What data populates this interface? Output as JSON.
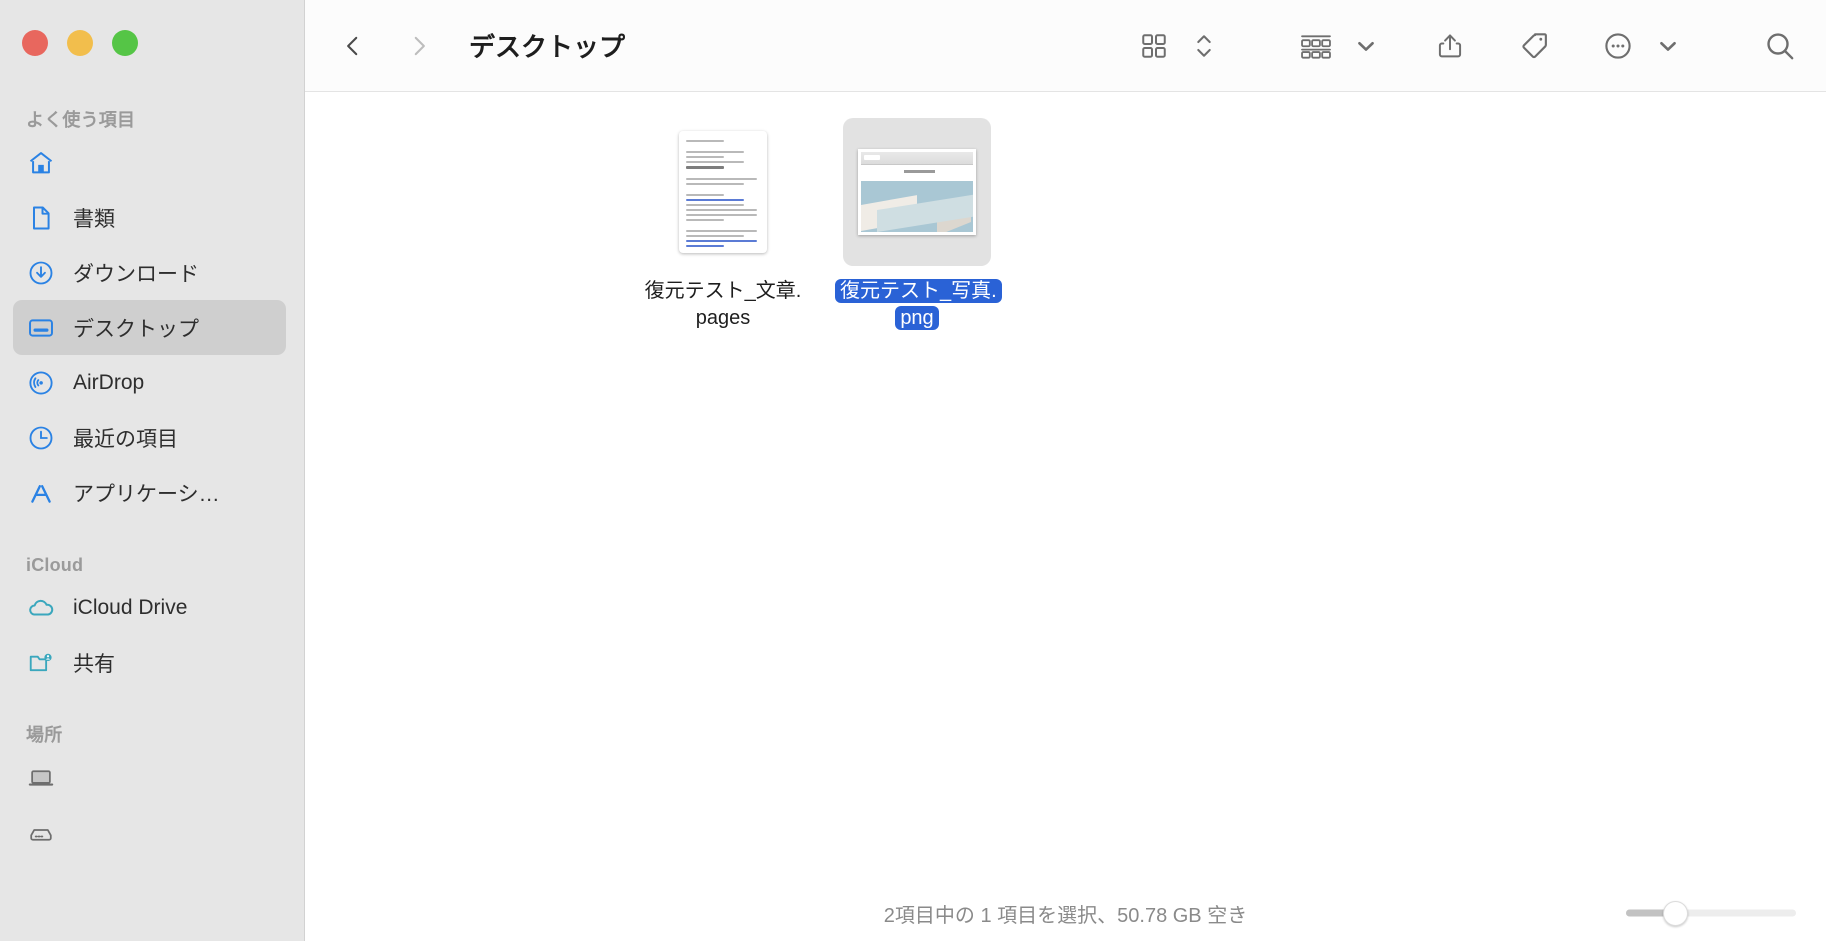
{
  "window": {
    "traffic_lights": [
      {
        "name": "close",
        "color": "#e8675e"
      },
      {
        "name": "minimize",
        "color": "#f2be4c"
      },
      {
        "name": "zoom",
        "color": "#55c546"
      }
    ]
  },
  "toolbar": {
    "back_label": "‹",
    "forward_label": "›",
    "folder_title": "デスクトップ",
    "icons": [
      "icon-view-icon",
      "view-sort-chevrons-icon",
      "group-by-icon",
      "group-by-chevron-icon",
      "share-icon",
      "tag-icon",
      "more-actions-icon",
      "more-actions-chevron-icon",
      "search-icon"
    ]
  },
  "sidebar": {
    "sections": [
      {
        "title": "よく使う項目",
        "items": [
          {
            "icon": "home-icon",
            "label": "",
            "selected": false
          },
          {
            "icon": "document-icon",
            "label": "書類",
            "selected": false
          },
          {
            "icon": "downloads-icon",
            "label": "ダウンロード",
            "selected": false
          },
          {
            "icon": "desktop-icon",
            "label": "デスクトップ",
            "selected": true
          },
          {
            "icon": "airdrop-icon",
            "label": "AirDrop",
            "selected": false
          },
          {
            "icon": "recents-clock-icon",
            "label": "最近の項目",
            "selected": false
          },
          {
            "icon": "applications-icon",
            "label": "アプリケーシ…",
            "selected": false
          }
        ]
      },
      {
        "title": "iCloud",
        "items": [
          {
            "icon": "cloud-icon",
            "label": "iCloud Drive",
            "selected": false
          },
          {
            "icon": "shared-folder-icon",
            "label": "共有",
            "selected": false
          }
        ]
      },
      {
        "title": "場所",
        "items": [
          {
            "icon": "laptop-icon",
            "label": "",
            "selected": false
          },
          {
            "icon": "external-disk-icon",
            "label": "",
            "selected": false
          }
        ]
      }
    ]
  },
  "files": [
    {
      "name": "復元テスト_文章.pages",
      "kind": "pages-document",
      "selected": false
    },
    {
      "name": "復元テスト_写真.png",
      "kind": "png-image",
      "selected": true
    }
  ],
  "status": {
    "text": "2項目中の 1 項目を選択、50.78 GB 空き"
  },
  "zoom_slider": {
    "name": "icon-size-slider",
    "value_percent": 24
  },
  "colors": {
    "sidebar_bg": "#e6e6e6",
    "selection_blue": "#2a62d6",
    "sidebar_icon_blue": "#2a82e4",
    "icloud_teal": "#3aa7bd",
    "toolbar_bg": "#fcfcfc",
    "content_bg": "#ffffff"
  }
}
